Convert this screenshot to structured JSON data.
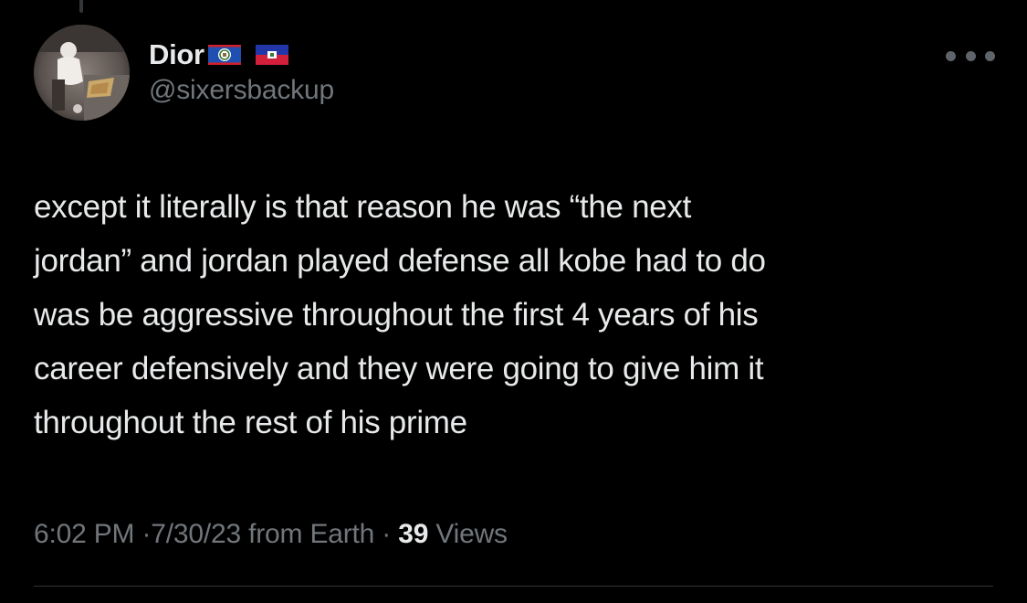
{
  "tweet": {
    "author": {
      "display_name": "Dior",
      "handle": "@sixersbackup",
      "flags": [
        "flag-belize-icon",
        "flag-haiti-icon"
      ]
    },
    "text_lines": [
      "except it literally is that reason he was “the next",
      "jordan” and jordan played defense all kobe had to do",
      "was be aggressive throughout the first 4 years of his",
      "career defensively and they were going to give him it",
      "throughout the rest of his prime"
    ],
    "meta": {
      "time": "6:02 PM",
      "separator": "·",
      "date": "7/30/23",
      "source": "from Earth",
      "views_count": "39",
      "views_label": "Views"
    }
  },
  "more_icon": "more-horizontal-icon",
  "colors": {
    "background": "#000000",
    "primary_text": "#e7e9ea",
    "secondary_text": "#71767b",
    "divider": "#2f3336"
  }
}
